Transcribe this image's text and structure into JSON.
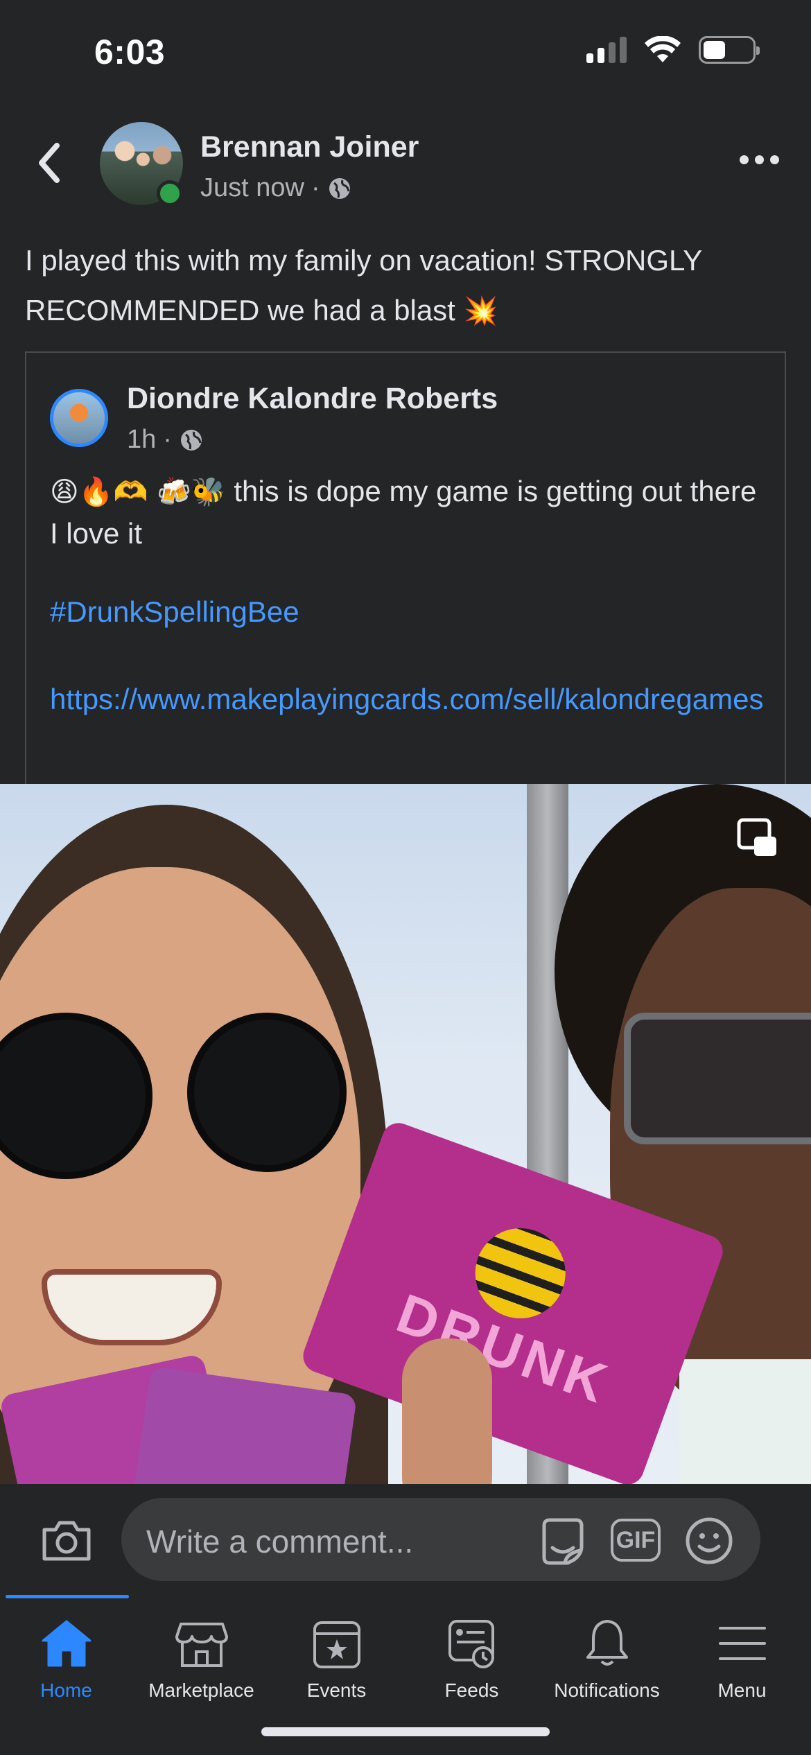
{
  "status_bar": {
    "time": "6:03"
  },
  "post": {
    "author": "Brennan Joiner",
    "time": "Just now",
    "text": "I played this with my family on vacation! STRONGLY RECOMMENDED we had a blast",
    "text_emoji": "💥"
  },
  "shared_post": {
    "author": "Diondre Kalondre Roberts",
    "time": "1h",
    "emojis": "😩🔥🫶 🍻🐝",
    "text": "this is dope my game is getting out there  I love it",
    "hashtag": "#DrunkSpellingBee",
    "link": "https://www.makeplayingcards.com/sell/kalondregames"
  },
  "video": {
    "card_text": "DRUNK"
  },
  "comment_bar": {
    "placeholder": "Write a comment...",
    "gif_label": "GIF"
  },
  "tabs": [
    {
      "label": "Home",
      "icon": "home-icon",
      "active": true
    },
    {
      "label": "Marketplace",
      "icon": "marketplace-icon"
    },
    {
      "label": "Events",
      "icon": "events-icon"
    },
    {
      "label": "Feeds",
      "icon": "feeds-icon"
    },
    {
      "label": "Notifications",
      "icon": "bell-icon"
    },
    {
      "label": "Menu",
      "icon": "menu-icon"
    }
  ],
  "colors": {
    "accent": "#2d88ff",
    "link": "#4599ff",
    "online": "#31a24c",
    "background": "#242526"
  }
}
